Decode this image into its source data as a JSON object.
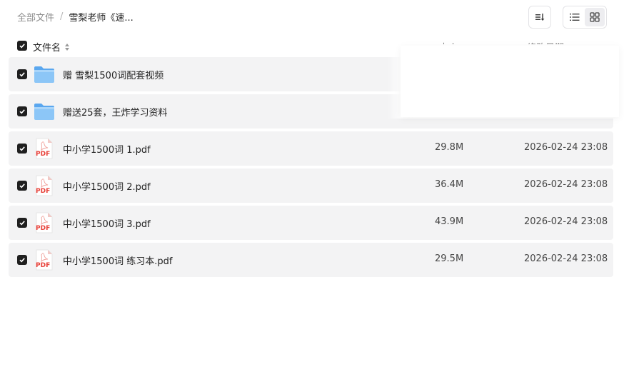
{
  "breadcrumb": {
    "root": "全部文件",
    "separator": "/",
    "current": "雪梨老师《速..."
  },
  "toolbar": {
    "sort_icon": "sort-descending-icon",
    "list_view_icon": "list-view-icon",
    "grid_view_icon": "grid-view-icon",
    "active_view": "grid"
  },
  "table": {
    "header": {
      "name": "文件名",
      "size": "大小",
      "date": "修改日期"
    },
    "rows": [
      {
        "type": "folder",
        "icon": "folder-icon",
        "name": "赠 雪梨1500词配套视频",
        "size": "",
        "date": ""
      },
      {
        "type": "folder",
        "icon": "folder-icon",
        "name": "赠送25套，王炸学习资料",
        "size": "",
        "date": ""
      },
      {
        "type": "pdf",
        "icon": "pdf-file-icon",
        "name": "中小学1500词 1.pdf",
        "size": "29.8M",
        "date": "2026-02-24 23:08"
      },
      {
        "type": "pdf",
        "icon": "pdf-file-icon",
        "name": "中小学1500词 2.pdf",
        "size": "36.4M",
        "date": "2026-02-24 23:08"
      },
      {
        "type": "pdf",
        "icon": "pdf-file-icon",
        "name": "中小学1500词 3.pdf",
        "size": "43.9M",
        "date": "2026-02-24 23:08"
      },
      {
        "type": "pdf",
        "icon": "pdf-file-icon",
        "name": "中小学1500词 练习本.pdf",
        "size": "29.5M",
        "date": "2026-02-24 23:08"
      }
    ]
  },
  "colors": {
    "row_background": "#f3f3f4",
    "checkbox": "#1f1f1f",
    "folder": "#7cbcf5",
    "pdf_red": "#e8423a"
  }
}
